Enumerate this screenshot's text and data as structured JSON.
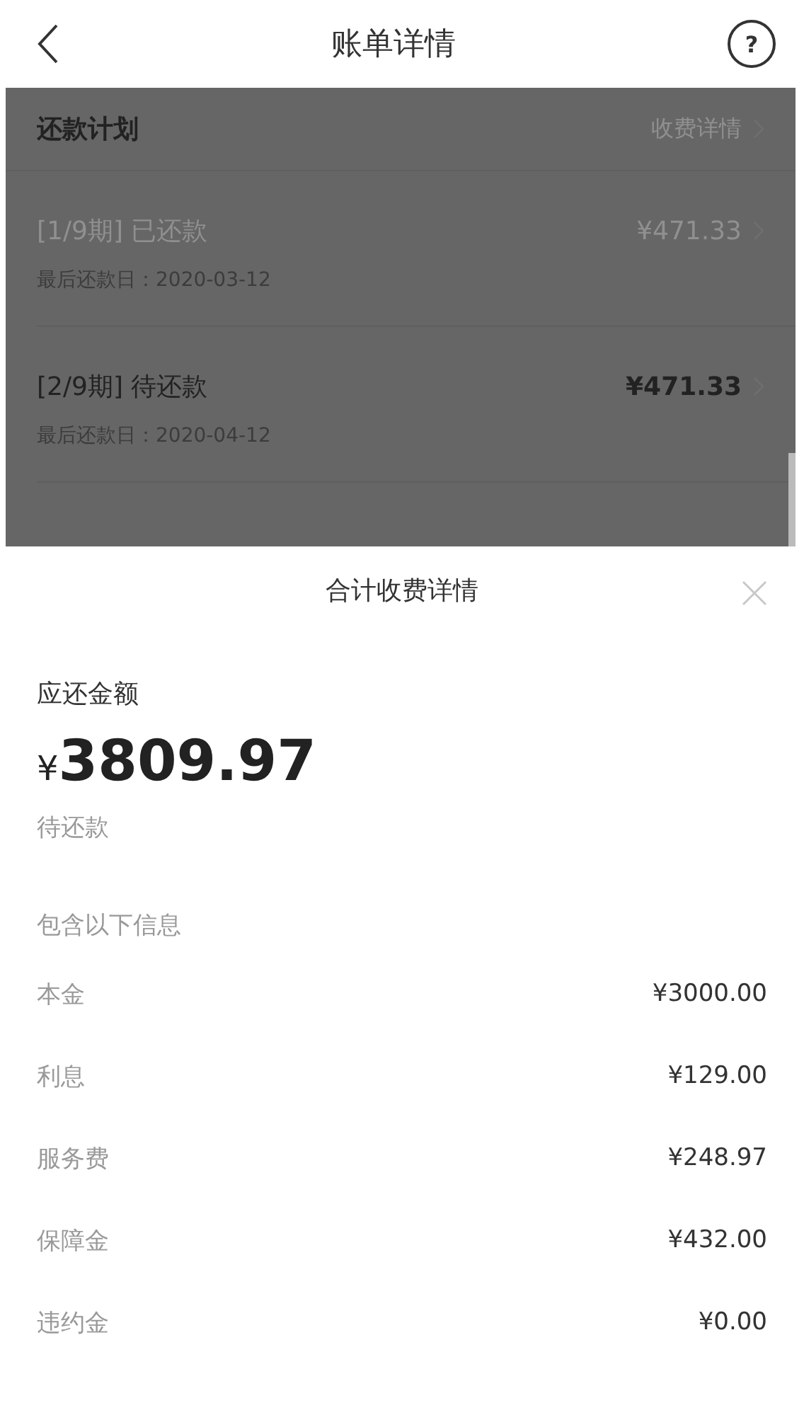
{
  "header": {
    "title": "账单详情",
    "help_icon": "?"
  },
  "plan": {
    "title": "还款计划",
    "link": "收费详情",
    "installments": [
      {
        "label": "[1/9期] 已还款",
        "amount": "¥471.33",
        "due": "最后还款日：2020-03-12",
        "paid": true
      },
      {
        "label": "[2/9期] 待还款",
        "amount": "¥471.33",
        "due": "最后还款日：2020-04-12",
        "paid": false
      }
    ]
  },
  "sheet": {
    "title": "合计收费详情",
    "amount_label": "应还金额",
    "currency": "¥",
    "amount": "3809.97",
    "status": "待还款",
    "section": "包含以下信息",
    "items": [
      {
        "label": "本金",
        "value": "¥3000.00"
      },
      {
        "label": "利息",
        "value": "¥129.00"
      },
      {
        "label": "服务费",
        "value": "¥248.97"
      },
      {
        "label": "保障金",
        "value": "¥432.00"
      },
      {
        "label": "违约金",
        "value": "¥0.00"
      }
    ]
  }
}
